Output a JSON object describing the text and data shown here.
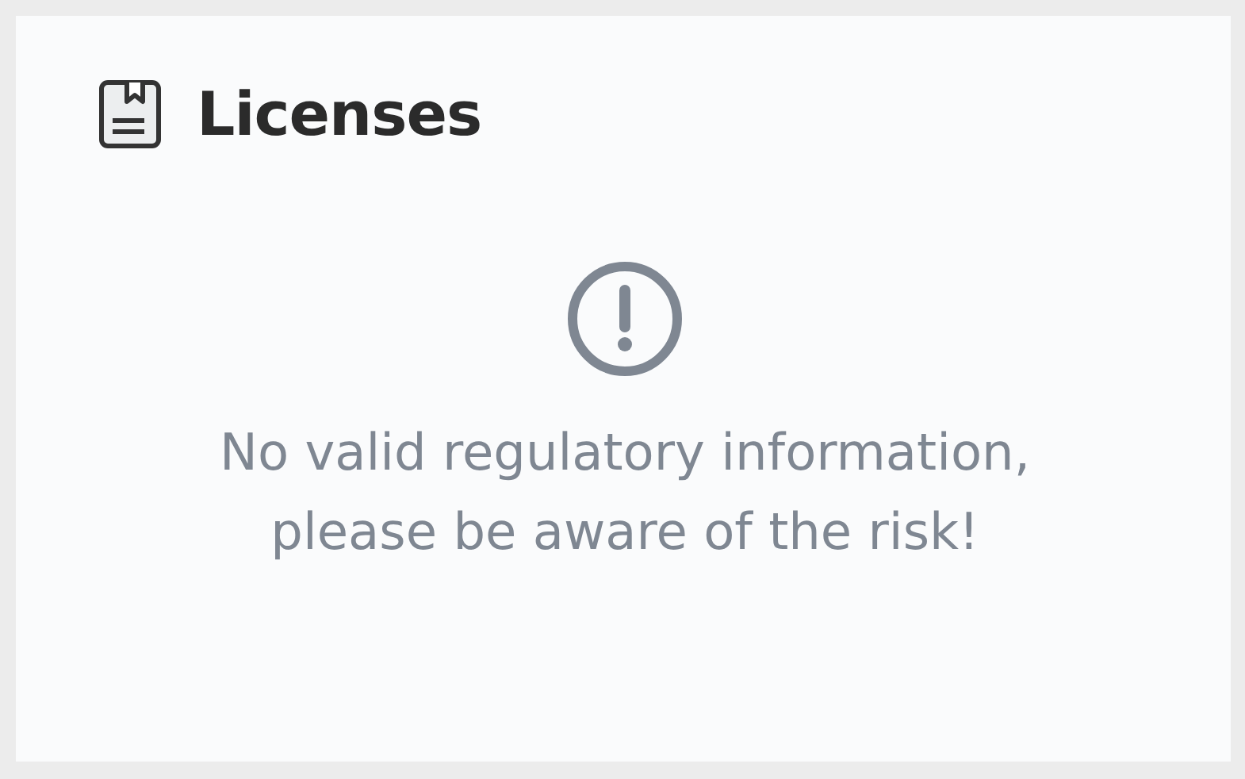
{
  "card": {
    "title": "Licenses"
  },
  "notice": {
    "message": "No valid regulatory information, please be aware of the risk!"
  }
}
